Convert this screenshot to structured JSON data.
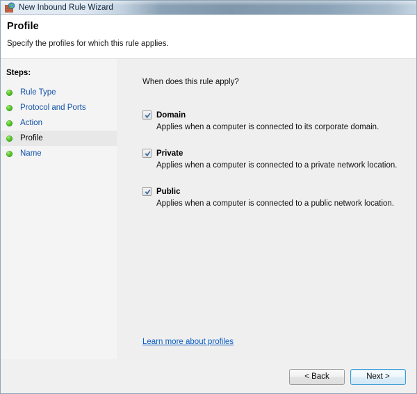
{
  "window": {
    "title": "New Inbound Rule Wizard",
    "icon": "firewall-globe-icon"
  },
  "header": {
    "title": "Profile",
    "subtitle": "Specify the profiles for which this rule applies."
  },
  "sidebar": {
    "label": "Steps:",
    "items": [
      {
        "label": "Rule Type",
        "current": false
      },
      {
        "label": "Protocol and Ports",
        "current": false
      },
      {
        "label": "Action",
        "current": false
      },
      {
        "label": "Profile",
        "current": true
      },
      {
        "label": "Name",
        "current": false
      }
    ]
  },
  "main": {
    "question": "When does this rule apply?",
    "profiles": [
      {
        "name": "Domain",
        "description": "Applies when a computer is connected to its corporate domain.",
        "checked": true
      },
      {
        "name": "Private",
        "description": "Applies when a computer is connected to a private network location.",
        "checked": true
      },
      {
        "name": "Public",
        "description": "Applies when a computer is connected to a public network location.",
        "checked": true
      }
    ],
    "learn_more": "Learn more about profiles"
  },
  "footer": {
    "back_label": "< Back",
    "next_label": "Next >"
  },
  "colors": {
    "link": "#0b5fc4",
    "step_link": "#1251a8",
    "check": "#3a6ea5",
    "bullet_green": "#5ec630",
    "default_button_border": "#3c9ad4"
  }
}
